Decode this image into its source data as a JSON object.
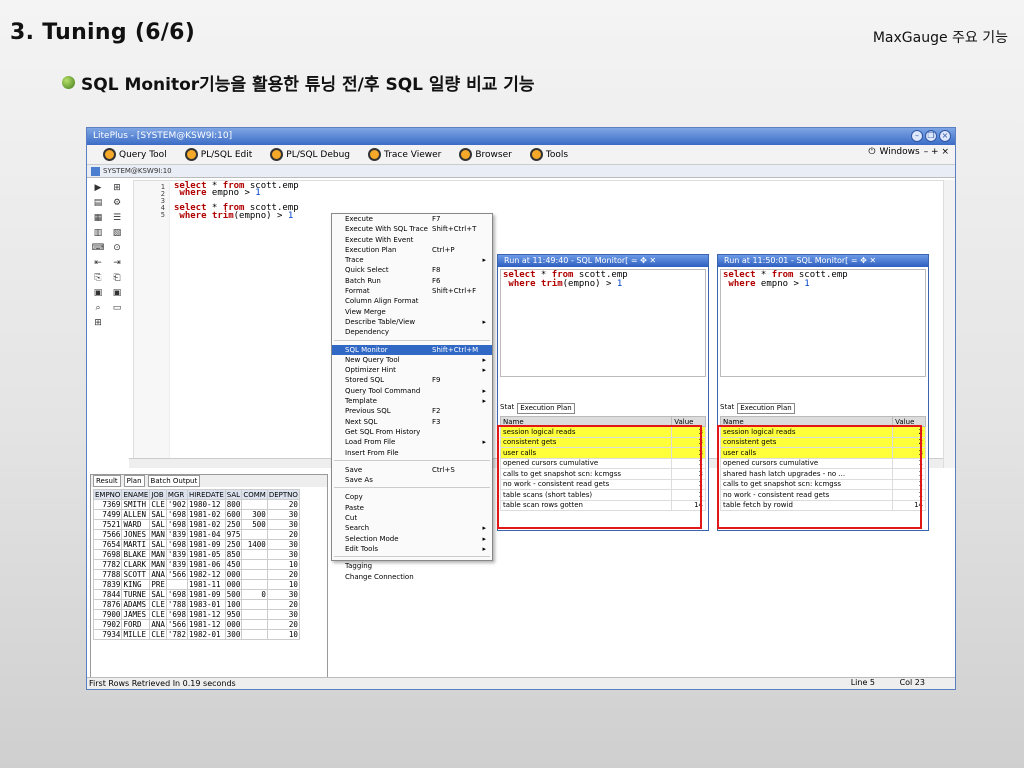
{
  "slide": {
    "title": "3. Tuning  (6/6)",
    "brand": "MaxGauge  주요 기능",
    "bullet": "SQL Monitor기능을 활용한 튜닝 전/후 SQL 일량 비교 기능"
  },
  "app": {
    "title": "LitePlus - [SYSTEM@KSW9I:10]",
    "toolbar": [
      "Query Tool",
      "PL/SQL Edit",
      "PL/SQL Debug",
      "Trace Viewer",
      "Browser",
      "Tools"
    ],
    "windows_label": "Windows",
    "connection": "SYSTEM@KSW9I:10"
  },
  "editor": {
    "line_numbers": [
      "1",
      "2",
      "3",
      "4",
      "5"
    ],
    "line1_kw1": "select",
    "line1_mid": " * ",
    "line1_kw2": "from",
    "line1_rest": " scott.emp",
    "line2_kw": "where",
    "line2_rest": " empno > ",
    "line2_num": "1",
    "line4_kw1": "select",
    "line4_mid": " * ",
    "line4_kw2": "from",
    "line4_rest": " scott.emp",
    "line5_kw": "where",
    "line5_mid": " ",
    "line5_fn": "trim",
    "line5_rest": "(empno) > ",
    "line5_num": "1"
  },
  "result": {
    "tabs": [
      "Result",
      "Plan",
      "Batch Output"
    ],
    "columns": [
      "EMPNO",
      "ENAME",
      "JOB",
      "MGR",
      "HIREDATE",
      "SAL",
      "COMM",
      "DEPTNO"
    ],
    "rows": [
      [
        "7369",
        "SMITH",
        "CLE",
        "'902",
        "1980-12",
        "800",
        "",
        "20"
      ],
      [
        "7499",
        "ALLEN",
        "SAL",
        "'698",
        "1981-02",
        "600",
        "300",
        "30"
      ],
      [
        "7521",
        "WARD",
        "SAL",
        "'698",
        "1981-02",
        "250",
        "500",
        "30"
      ],
      [
        "7566",
        "JONES",
        "MAN",
        "'839",
        "1981-04",
        "975",
        "",
        "20"
      ],
      [
        "7654",
        "MARTI",
        "SAL",
        "'698",
        "1981-09",
        "250",
        "1400",
        "30"
      ],
      [
        "7698",
        "BLAKE",
        "MAN",
        "'839",
        "1981-05",
        "850",
        "",
        "30"
      ],
      [
        "7782",
        "CLARK",
        "MAN",
        "'839",
        "1981-06",
        "450",
        "",
        "10"
      ],
      [
        "7788",
        "SCOTT",
        "ANA",
        "'566",
        "1982-12",
        "000",
        "",
        "20"
      ],
      [
        "7839",
        "KING",
        "PRE",
        "",
        "1981-11",
        "000",
        "",
        "10"
      ],
      [
        "7844",
        "TURNE",
        "SAL",
        "'698",
        "1981-09",
        "500",
        "0",
        "30"
      ],
      [
        "7876",
        "ADAMS",
        "CLE",
        "'788",
        "1983-01",
        "100",
        "",
        "20"
      ],
      [
        "7900",
        "JAMES",
        "CLE",
        "'698",
        "1981-12",
        "950",
        "",
        "30"
      ],
      [
        "7902",
        "FORD",
        "ANA",
        "'566",
        "1981-12",
        "000",
        "",
        "20"
      ],
      [
        "7934",
        "MILLE",
        "CLE",
        "'782",
        "1982-01",
        "300",
        "",
        "10"
      ]
    ]
  },
  "status": {
    "message": "First Rows Retrieved In 0.19 seconds",
    "line": "Line 5",
    "col": "Col 23"
  },
  "menu": {
    "items": [
      {
        "label": "Execute",
        "shortcut": "F7",
        "arrow": ""
      },
      {
        "label": "Execute With SQL Trace",
        "shortcut": "Shift+Ctrl+T",
        "arrow": ""
      },
      {
        "label": "Execute With Event",
        "shortcut": "",
        "arrow": ""
      },
      {
        "label": "Execution Plan",
        "shortcut": "Ctrl+P",
        "arrow": ""
      },
      {
        "label": "Trace",
        "shortcut": "",
        "arrow": "▸"
      },
      {
        "label": "Quick Select",
        "shortcut": "F8",
        "arrow": ""
      },
      {
        "label": "Batch Run",
        "shortcut": "F6",
        "arrow": ""
      },
      {
        "label": "Format",
        "shortcut": "Shift+Ctrl+F",
        "arrow": ""
      },
      {
        "label": "Column Align Format",
        "shortcut": "",
        "arrow": ""
      },
      {
        "label": "View Merge",
        "shortcut": "",
        "arrow": ""
      },
      {
        "label": "Describe Table/View",
        "shortcut": "",
        "arrow": "▸"
      },
      {
        "label": "Dependency",
        "shortcut": "",
        "arrow": ""
      },
      {
        "sep": true
      },
      {
        "label": "SQL Monitor",
        "shortcut": "Shift+Ctrl+M",
        "arrow": "",
        "selected": true
      },
      {
        "label": "New Query Tool",
        "shortcut": "",
        "arrow": "▸"
      },
      {
        "label": "Optimizer Hint",
        "shortcut": "",
        "arrow": "▸"
      },
      {
        "label": "Stored SQL",
        "shortcut": "F9",
        "arrow": ""
      },
      {
        "label": "Query Tool Command",
        "shortcut": "",
        "arrow": "▸"
      },
      {
        "label": "Template",
        "shortcut": "",
        "arrow": "▸"
      },
      {
        "label": "Previous SQL",
        "shortcut": "F2",
        "arrow": ""
      },
      {
        "label": "Next SQL",
        "shortcut": "F3",
        "arrow": ""
      },
      {
        "label": "Get SQL From History",
        "shortcut": "",
        "arrow": ""
      },
      {
        "label": "Load From File",
        "shortcut": "",
        "arrow": "▸"
      },
      {
        "label": "Insert From File",
        "shortcut": "",
        "arrow": ""
      },
      {
        "sep": true
      },
      {
        "label": "Save",
        "shortcut": "Ctrl+S",
        "arrow": ""
      },
      {
        "label": "Save As",
        "shortcut": "",
        "arrow": ""
      },
      {
        "sep": true
      },
      {
        "label": "Copy",
        "shortcut": "",
        "arrow": ""
      },
      {
        "label": "Paste",
        "shortcut": "",
        "arrow": ""
      },
      {
        "label": "Cut",
        "shortcut": "",
        "arrow": ""
      },
      {
        "label": "Search",
        "shortcut": "",
        "arrow": "▸"
      },
      {
        "label": "Selection Mode",
        "shortcut": "",
        "arrow": "▸"
      },
      {
        "label": "Edit Tools",
        "shortcut": "",
        "arrow": "▸"
      },
      {
        "sep": true
      },
      {
        "label": "Tagging",
        "shortcut": "",
        "arrow": ""
      },
      {
        "label": "Change Connection",
        "shortcut": "",
        "arrow": ""
      }
    ]
  },
  "monitor1": {
    "title": "Run at  11:49:40  - SQL Monitor[",
    "sql_line1_kw1": "select",
    "sql_line1_mid": " * ",
    "sql_line1_kw2": "from",
    "sql_line1_rest": " scott.emp",
    "sql_line2_kw": " where",
    "sql_line2_mid": " ",
    "sql_line2_fn": "trim",
    "sql_line2_rest": "(empno) > ",
    "sql_line2_num": "1",
    "tabs": [
      "Stat",
      "Execution Plan"
    ],
    "col_name": "Name",
    "col_value": "Value",
    "stats": [
      {
        "name": "session logical reads",
        "value": "3",
        "hl": true
      },
      {
        "name": "consistent gets",
        "value": "3",
        "hl": true
      },
      {
        "name": "user calls",
        "value": "3",
        "hl": true
      },
      {
        "name": "opened cursors cumulative",
        "value": "1"
      },
      {
        "name": "calls to get snapshot scn: kcmgss",
        "value": "3"
      },
      {
        "name": "no work - consistent read gets",
        "value": "1"
      },
      {
        "name": "table scans (short tables)",
        "value": "1"
      },
      {
        "name": "table scan rows gotten",
        "value": "14"
      }
    ]
  },
  "monitor2": {
    "title": "Run at  11:50:01  - SQL Monitor[",
    "sql_line1_kw1": "select",
    "sql_line1_mid": " * ",
    "sql_line1_kw2": "from",
    "sql_line1_rest": " scott.emp",
    "sql_line2_kw": " where",
    "sql_line2_rest": " empno > ",
    "sql_line2_num": "1",
    "tabs": [
      "Stat",
      "Execution Plan"
    ],
    "col_name": "Name",
    "col_value": "Value",
    "stats": [
      {
        "name": "session logical reads",
        "value": "2",
        "hl": true
      },
      {
        "name": "consistent gets",
        "value": "2",
        "hl": true
      },
      {
        "name": "user calls",
        "value": "3",
        "hl": true
      },
      {
        "name": "opened cursors cumulative",
        "value": "1"
      },
      {
        "name": "shared hash latch upgrades - no ...",
        "value": "1"
      },
      {
        "name": "calls to get snapshot scn: kcmgss",
        "value": "1"
      },
      {
        "name": "no work - consistent read gets",
        "value": "1"
      },
      {
        "name": "table fetch by rowid",
        "value": "14"
      }
    ]
  },
  "colors": {
    "highlight": "#ffff3a",
    "redbox": "#e21818",
    "menu_select": "#3168c6"
  }
}
